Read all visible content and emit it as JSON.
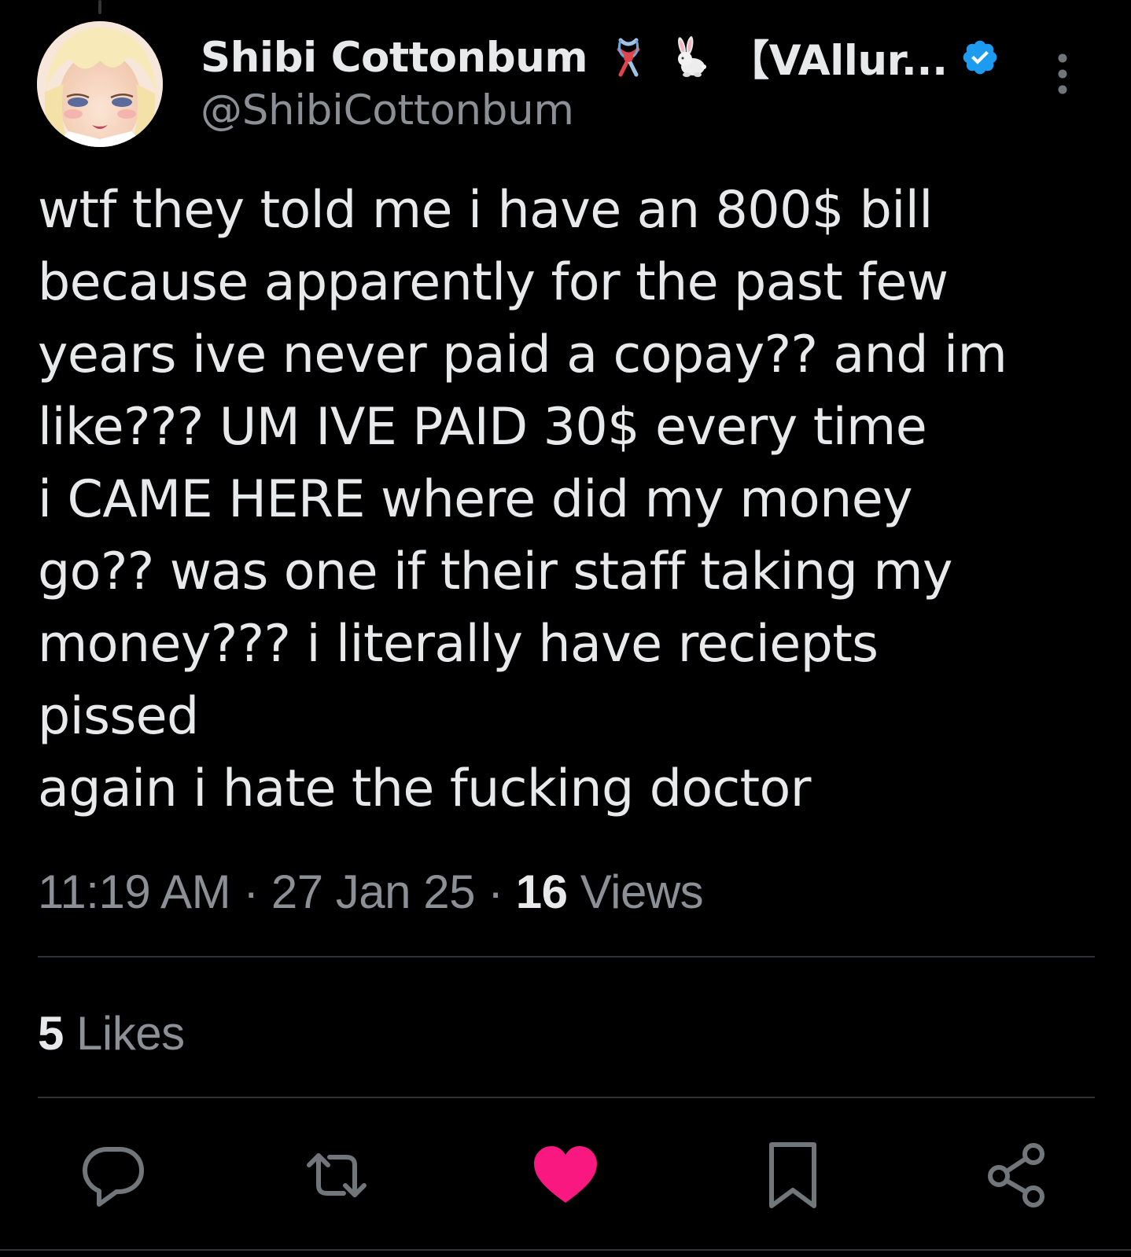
{
  "author": {
    "display_name": "Shibi Cottonbum",
    "affiliation": "【VAllur...",
    "handle": "@ShibiCottonbum",
    "icons": [
      "ribbon-knot-emoji",
      "rabbit-emoji",
      "verified-badge-icon"
    ],
    "verified_color": "#1d9bf0"
  },
  "tweet": {
    "lines": [
      "wtf they told me i have an 800$ bill",
      "because apparently for the past few",
      "years ive never paid a copay?? and im",
      "like??? UM IVE PAID 30$ every time",
      "i CAME HERE where did my money",
      "go?? was one if their staff taking my",
      "money??? i literally have reciepts",
      "pissed",
      "again i hate the fucking doctor"
    ]
  },
  "meta": {
    "time": "11:19 AM",
    "sep1": " · ",
    "date": "27 Jan 25",
    "sep2": " · ",
    "views_count": "16",
    "views_label": " Views"
  },
  "stats": {
    "likes_count": "5",
    "likes_label": " Likes"
  },
  "actions": {
    "icons": [
      "reply-icon",
      "retweet-icon",
      "like-icon",
      "bookmark-icon",
      "share-icon"
    ],
    "like_active_color": "#f91880",
    "icon_color": "#71767b"
  }
}
